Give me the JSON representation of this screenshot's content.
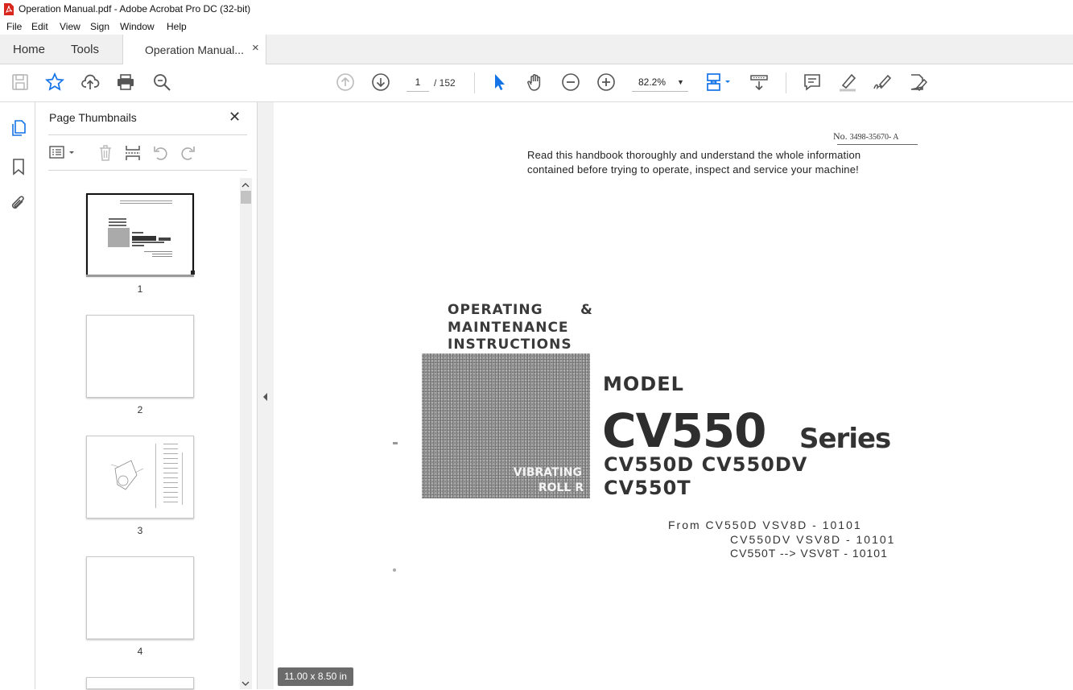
{
  "window": {
    "title": "Operation Manual.pdf - Adobe Acrobat Pro DC (32-bit)"
  },
  "menu": [
    "File",
    "Edit",
    "View",
    "Sign",
    "Window",
    "Help"
  ],
  "tabs": {
    "home": "Home",
    "tools": "Tools",
    "document": "Operation Manual...",
    "close": "×"
  },
  "toolbar": {
    "page_current": "1",
    "page_total": "/ 152",
    "zoom": "82.2%",
    "zoom_caret": "▼"
  },
  "sidebar": {
    "title": "Page Thumbnails",
    "close": "✕",
    "thumbnails": [
      {
        "label": "1"
      },
      {
        "label": "2"
      },
      {
        "label": "3"
      },
      {
        "label": "4"
      }
    ]
  },
  "document": {
    "doc_no_prefix": "No.",
    "doc_no": "3498-35670- A",
    "warning_line1": "Read this handbook thoroughly and understand the whole information",
    "warning_line2": "contained before trying to operate, inspect and service your machine!",
    "heading_line1": "OPERATING",
    "heading_amp": "&",
    "heading_line2": "MAINTENANCE",
    "heading_line3": "INSTRUCTIONS",
    "photo_text1": "VIBRATING",
    "photo_text2": "ROLL R",
    "model_label": "MODEL",
    "model_big": "CV550",
    "series": "Series",
    "variants_line1": "CV550D CV550DV",
    "variants_line2": "CV550T",
    "from_line1": "From CV550D VSV8D - 10101",
    "from_line2": "CV550DV VSV8D - 10101",
    "from_line3": "CV550T --> VSV8T - 10101"
  },
  "status": {
    "page_size": "11.00 x 8.50 in"
  },
  "colors": {
    "accent": "#1473e6",
    "icon": "#555555"
  }
}
